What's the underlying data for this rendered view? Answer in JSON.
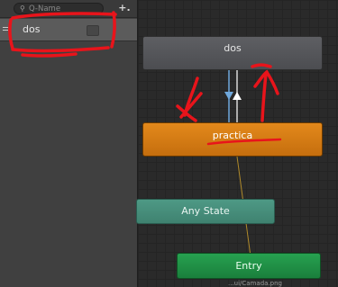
{
  "toolbar": {
    "search_placeholder": "Q-Name",
    "add_label": "+."
  },
  "layers": [
    {
      "name": "dos"
    }
  ],
  "graph": {
    "states": {
      "dos": "dos",
      "practica": "practica",
      "any_state": "Any State",
      "entry": "Entry"
    },
    "footer_fragment": "...ui/Camada.png"
  },
  "colors": {
    "default_state": "#55565a",
    "practica_state": "#d97b15",
    "any_state": "#47907c",
    "entry_state": "#1f8f45",
    "scribble": "#e8141b"
  }
}
